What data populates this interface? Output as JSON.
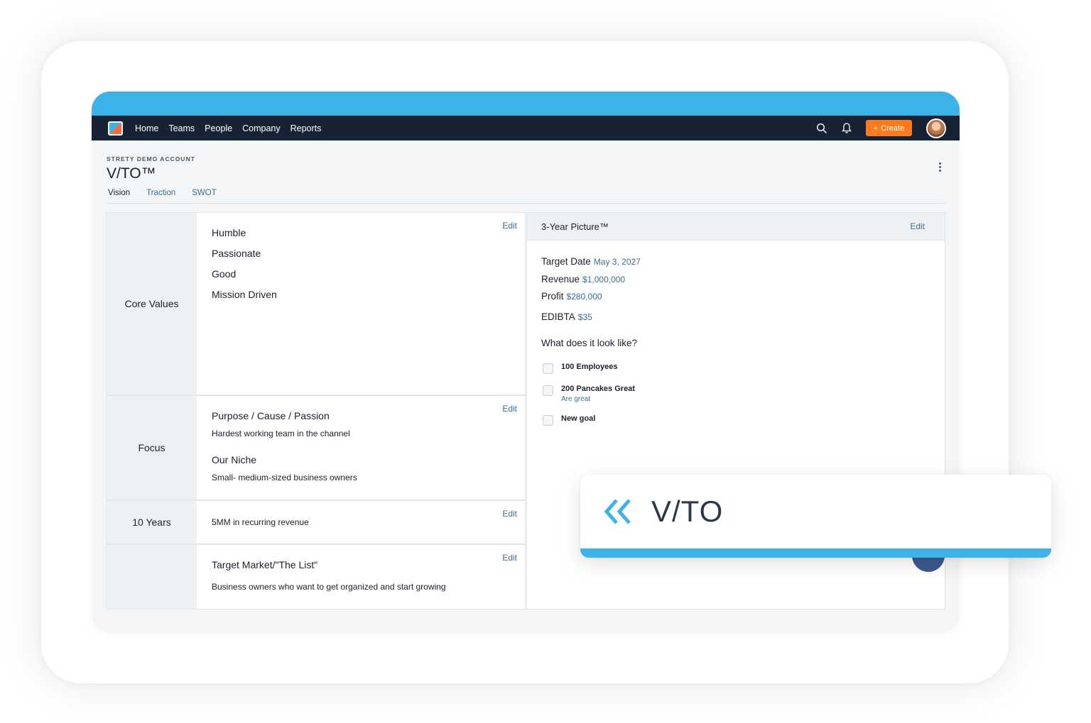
{
  "nav": {
    "links": [
      "Home",
      "Teams",
      "People",
      "Company",
      "Reports"
    ],
    "create_label": "Create",
    "create_plus": "+"
  },
  "page": {
    "account": "STRETY DEMO ACCOUNT",
    "title": "V/TO™",
    "tabs": [
      "Vision",
      "Traction",
      "SWOT"
    ]
  },
  "edit_label": "Edit",
  "core_values": {
    "label": "Core Values",
    "items": [
      "Humble",
      "Passionate",
      "Good",
      "Mission Driven"
    ]
  },
  "focus": {
    "label": "Focus",
    "purpose_heading": "Purpose / Cause / Passion",
    "purpose_text": "Hardest working team in the channel",
    "niche_heading": "Our Niche",
    "niche_text": "Small- medium-sized business owners"
  },
  "ten_years": {
    "label": "10 Years",
    "text": "5MM in recurring revenue"
  },
  "target_market": {
    "heading": "Target Market/\"The List\"",
    "text": "Business owners who want to get organized and start growing"
  },
  "three_year": {
    "title": "3-Year Picture™",
    "metrics": [
      {
        "label": "Target Date",
        "value": "May 3, 2027"
      },
      {
        "label": "Revenue",
        "value": "$1,000,000"
      },
      {
        "label": "Profit",
        "value": "$280,000"
      },
      {
        "label": "EDIBTA",
        "value": "$35"
      }
    ],
    "question": "What does it look like?",
    "goals": [
      {
        "title": "100 Employees",
        "sub": ""
      },
      {
        "title": "200 Pancakes Great",
        "sub": "Are great"
      },
      {
        "title": "New goal",
        "sub": ""
      }
    ]
  },
  "overlay": {
    "text": "V/TO",
    "accent": "#3db2e6"
  },
  "colors": {
    "top_band": "#3db2e6",
    "navbar": "#172234",
    "create": "#ff7a1a",
    "link": "#3b6f92"
  }
}
